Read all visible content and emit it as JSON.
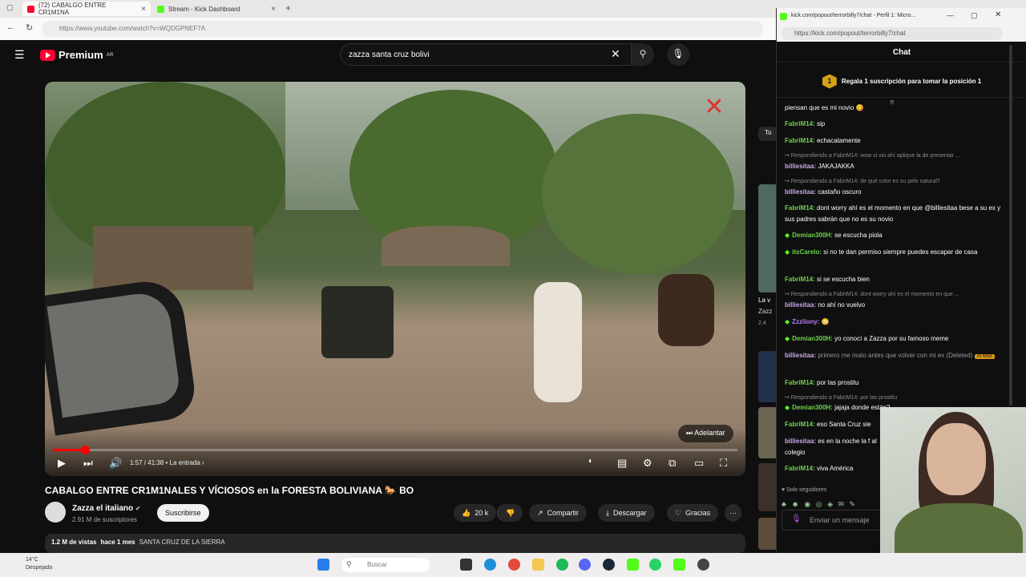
{
  "browser": {
    "tabs": [
      {
        "title": "(72) CABALGO ENTRE CR1M1NA",
        "active": true
      },
      {
        "title": "Stream - Kick Dashboard",
        "active": false
      }
    ],
    "url": "https://www.youtube.com/watch?v=WQDGPNEF7A"
  },
  "youtube": {
    "logo_text": "Premium",
    "logo_region": "AR",
    "search_value": "zazza santa cruz bolivi",
    "video_title": "CABALGO ENTRE CR1M1NALES Y VÍCIOSOS en la FORESTA BOLIVIANA 🐎 BO",
    "channel_name": "Zazza el italiano",
    "channel_subs": "2.91 M de suscriptores",
    "subscribe_label": "Suscribirse",
    "likes": "20 k",
    "share_label": "Compartir",
    "download_label": "Descargar",
    "thanks_label": "Gracias",
    "more_label": "···",
    "views": "1.2 M de vistas",
    "age": "hace 1 mes",
    "location": "SANTA CRUZ DE LA SIERRA",
    "time": "1:57 / 41:38",
    "chapter": "• La entrada ›",
    "skip_label": "Adelantar",
    "progress": 0.047
  },
  "right_column": {
    "tab_label": "To",
    "snippet_1": "La v",
    "snippet_2": "Zazz",
    "snippet_3": "2.4"
  },
  "chat": {
    "window_title": "kick.com/popout/terrorbilly7/chat - Perfil 1: Micro...",
    "url": "https://kick.com/popout/terrorbilly7/chat",
    "header": "Chat",
    "gift_rank": "1",
    "gift_text": "Regala 1 suscripción para tomar la posición 1",
    "messages": [
      {
        "user": "",
        "text": "piensan que es mi novio 😋"
      },
      {
        "user": "FabriM14:",
        "text": " sip"
      },
      {
        "user": "FabriM14:",
        "text": " echacatamente"
      },
      {
        "reply": "↪ Respondiendo a FabriM14: wow si vio ahí aplique la de presentar ..."
      },
      {
        "user": "billiesitaa:",
        "text": " JAKAJAKKA"
      },
      {
        "reply": "↪ Respondiendo a FabriM14: de qué color es su pelo natural?"
      },
      {
        "user": "billiesitaa:",
        "text": " castaño oscuro"
      },
      {
        "user": "FabriM14:",
        "text": " dont worry ahí es el momento en que @billiesitaa bese a su ex y sus padres sabrán que no es su novio"
      },
      {
        "user": "Demian300H:",
        "text": " se escucha piola"
      },
      {
        "user": "itsCarelo:",
        "text": " si no te dan permiso siempre puedes escapar de casa"
      },
      {
        "user": "FabriM14:",
        "text": " si se escucha bien"
      },
      {
        "reply": "↪ Respondiendo a FabriM14: dont worry ahí es el momento en que ..."
      },
      {
        "user": "billiesitaa:",
        "text": " no ahí no vuelvo"
      },
      {
        "user": "Zzzilony:",
        "text": " 😳"
      },
      {
        "user": "Demian300H:",
        "text": " yo conocí a Zazza por su famoso meme"
      },
      {
        "user": "billiesitaa:",
        "text": " primero me mato antes que volver con mi ex (Deleted)",
        "mod": "AI Mod"
      },
      {
        "user": "FabriM14:",
        "text": " por las prostitu"
      },
      {
        "reply": "↪ Respondiendo a FabriM14: por las prostitu"
      },
      {
        "user": "Demian300H:",
        "text": " jajaja donde están?"
      },
      {
        "user": "FabriM14:",
        "text": " eso Santa Cruz sie"
      },
      {
        "user": "billiesitaa:",
        "text": " es en la noche la f al colegio"
      },
      {
        "user": "FabriM14:",
        "text": " viva América"
      }
    ],
    "followers_only": "♥ Solo seguidores",
    "input_placeholder": "Enviar un mensaje"
  },
  "taskbar": {
    "temp": "14°C",
    "weather": "Despejado",
    "search_placeholder": "Buscar"
  },
  "colors": {
    "yt_red": "#ff0033",
    "kick_green": "#53fc18"
  }
}
